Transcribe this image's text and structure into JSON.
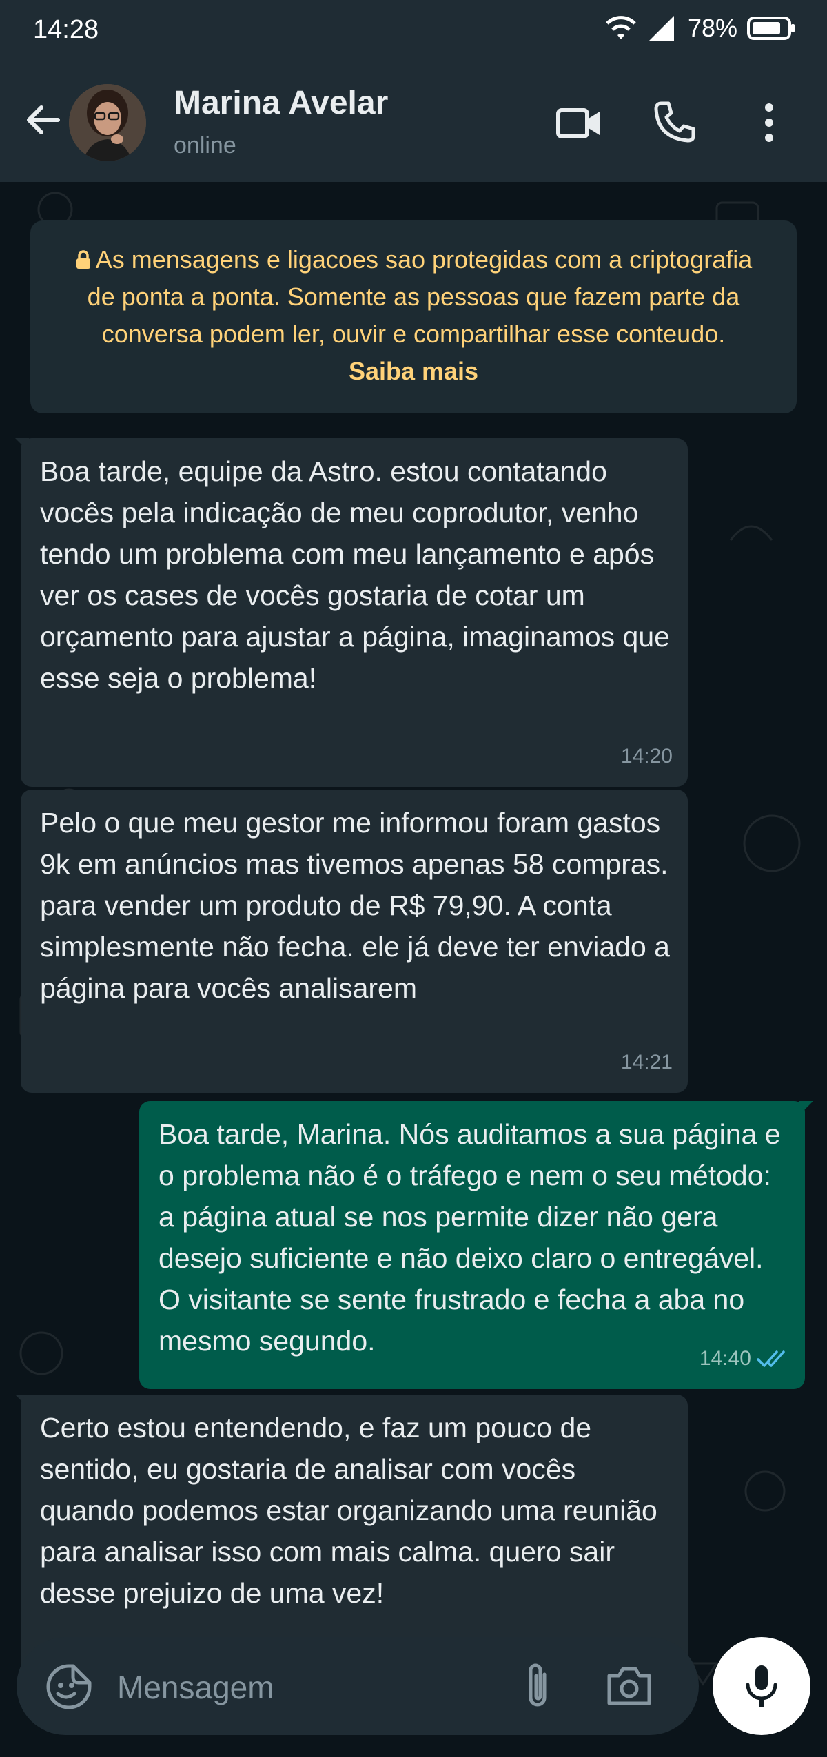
{
  "status_bar": {
    "time": "14:28",
    "battery": "78%"
  },
  "header": {
    "name": "Marina Avelar",
    "status": "online"
  },
  "notice": {
    "text": "As mensagens e ligacoes sao protegidas com a criptografia de ponta a ponta. Somente as pessoas que fazem parte da conversa podem ler, ouvir e compartilhar esse conteudo.",
    "link": "Saiba mais"
  },
  "messages": [
    {
      "direction": "incoming",
      "text": "Boa tarde, equipe da Astro. estou contatando vocês pela indicação de meu coprodutor, venho tendo um problema com meu lançamento e após ver os cases de vocês gostaria de cotar um orçamento para ajustar a página, imaginamos que esse seja o problema!",
      "time": "14:20"
    },
    {
      "direction": "incoming",
      "text": "Pelo o que meu gestor me informou foram gastos 9k em anúncios mas tivemos apenas 58 compras. para vender um produto de R$ 79,90. A conta simplesmente não fecha. ele já deve ter enviado a página para vocês analisarem",
      "time": "14:21"
    },
    {
      "direction": "outgoing",
      "text": "Boa tarde, Marina. Nós auditamos a sua página e o problema não é o tráfego e nem o seu método: a página atual se nos permite dizer não gera desejo suficiente e não deixo claro o entregável. O visitante se sente frustrado e fecha a aba no mesmo segundo.",
      "time": "14:40",
      "read": true
    },
    {
      "direction": "incoming",
      "text": "Certo estou entendendo, e faz um pouco de sentido, eu gostaria de analisar com vocês quando podemos estar organizando uma reunião para analisar isso com mais calma. quero sair desse prejuizo de uma vez!",
      "time": ""
    }
  ],
  "composer": {
    "placeholder": "Mensagem"
  },
  "colors": {
    "incoming": "#202c33",
    "outgoing": "#005c4b",
    "notice": "#ffd279",
    "read_ticks": "#53bdeb"
  }
}
